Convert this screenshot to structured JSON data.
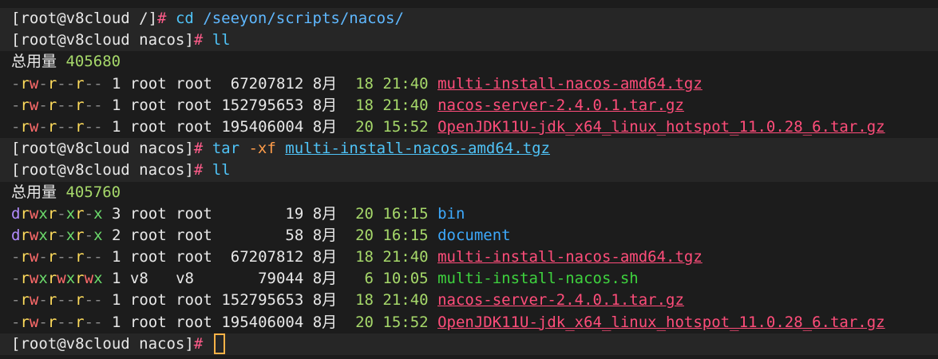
{
  "colors": {
    "background": "#1c1c1c",
    "prompt_hash": "#ff5c8a",
    "command": "#4fc3f7",
    "archive": "#ff4d7a",
    "directory": "#3da9fc",
    "executable": "#3ed23e",
    "cursor": "#ffb347"
  },
  "prompt": {
    "root_dir": "[root@v8cloud /]",
    "nacos_dir": "[root@v8cloud nacos]",
    "hash": "#"
  },
  "commands": {
    "cd": "cd",
    "cd_path": "/seeyon/scripts/nacos/",
    "ll": "ll",
    "tar": "tar",
    "tar_flag": "-xf",
    "tar_arg": "multi-install-nacos-amd64.tgz"
  },
  "listing1": {
    "total_label": "总用量",
    "total_value": "405680",
    "rows": [
      {
        "perm": "-rw-r--r--",
        "links": "1",
        "owner": "root",
        "group": "root",
        "size": " 67207812",
        "month": "8月",
        "day": "18",
        "time": "21:40",
        "name": "multi-install-nacos-amd64.tgz"
      },
      {
        "perm": "-rw-r--r--",
        "links": "1",
        "owner": "root",
        "group": "root",
        "size": "152795653",
        "month": "8月",
        "day": "18",
        "time": "21:40",
        "name": "nacos-server-2.4.0.1.tar.gz"
      },
      {
        "perm": "-rw-r--r--",
        "links": "1",
        "owner": "root",
        "group": "root",
        "size": "195406004",
        "month": "8月",
        "day": "20",
        "time": "15:52",
        "name": "OpenJDK11U-jdk_x64_linux_hotspot_11.0.28_6.tar.gz"
      }
    ]
  },
  "listing2": {
    "total_label": "总用量",
    "total_value": "405760",
    "rows": [
      {
        "perm": "drwxr-xr-x",
        "links": "3",
        "owner": "root",
        "group": "root",
        "size": "       19",
        "month": "8月",
        "day": "20",
        "time": "16:15",
        "name": "bin"
      },
      {
        "perm": "drwxr-xr-x",
        "links": "2",
        "owner": "root",
        "group": "root",
        "size": "       58",
        "month": "8月",
        "day": "20",
        "time": "16:15",
        "name": "document"
      },
      {
        "perm": "-rw-r--r--",
        "links": "1",
        "owner": "root",
        "group": "root",
        "size": " 67207812",
        "month": "8月",
        "day": "18",
        "time": "21:40",
        "name": "multi-install-nacos-amd64.tgz"
      },
      {
        "perm": "-rwxrwxrwx",
        "links": "1",
        "owner": "v8  ",
        "group": "v8  ",
        "size": "    79044",
        "month": "8月",
        "day": " 6",
        "time": "10:05",
        "name": "multi-install-nacos.sh"
      },
      {
        "perm": "-rw-r--r--",
        "links": "1",
        "owner": "root",
        "group": "root",
        "size": "152795653",
        "month": "8月",
        "day": "18",
        "time": "21:40",
        "name": "nacos-server-2.4.0.1.tar.gz"
      },
      {
        "perm": "-rw-r--r--",
        "links": "1",
        "owner": "root",
        "group": "root",
        "size": "195406004",
        "month": "8月",
        "day": "20",
        "time": "15:52",
        "name": "OpenJDK11U-jdk_x64_linux_hotspot_11.0.28_6.tar.gz"
      }
    ]
  }
}
